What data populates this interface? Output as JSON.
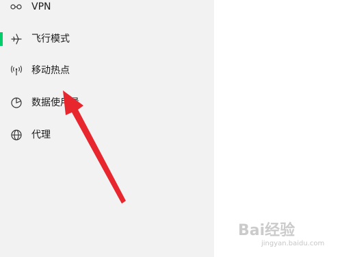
{
  "nav": {
    "items": [
      {
        "icon": "vpn-icon",
        "label": "VPN",
        "selected": false
      },
      {
        "icon": "airplane-icon",
        "label": "飞行模式",
        "selected": true
      },
      {
        "icon": "hotspot-icon",
        "label": "移动热点",
        "selected": false
      },
      {
        "icon": "data-usage-icon",
        "label": "数据使用量",
        "selected": false
      },
      {
        "icon": "globe-icon",
        "label": "代理",
        "selected": false
      }
    ]
  },
  "colors": {
    "sidebar_bg": "#f2f2f2",
    "accent": "#00cc6a",
    "arrow": "#e8262e",
    "text": "#1a1a1a"
  },
  "watermark": {
    "logo_text": "Bai经验",
    "url": "jingyan.baidu.com"
  }
}
